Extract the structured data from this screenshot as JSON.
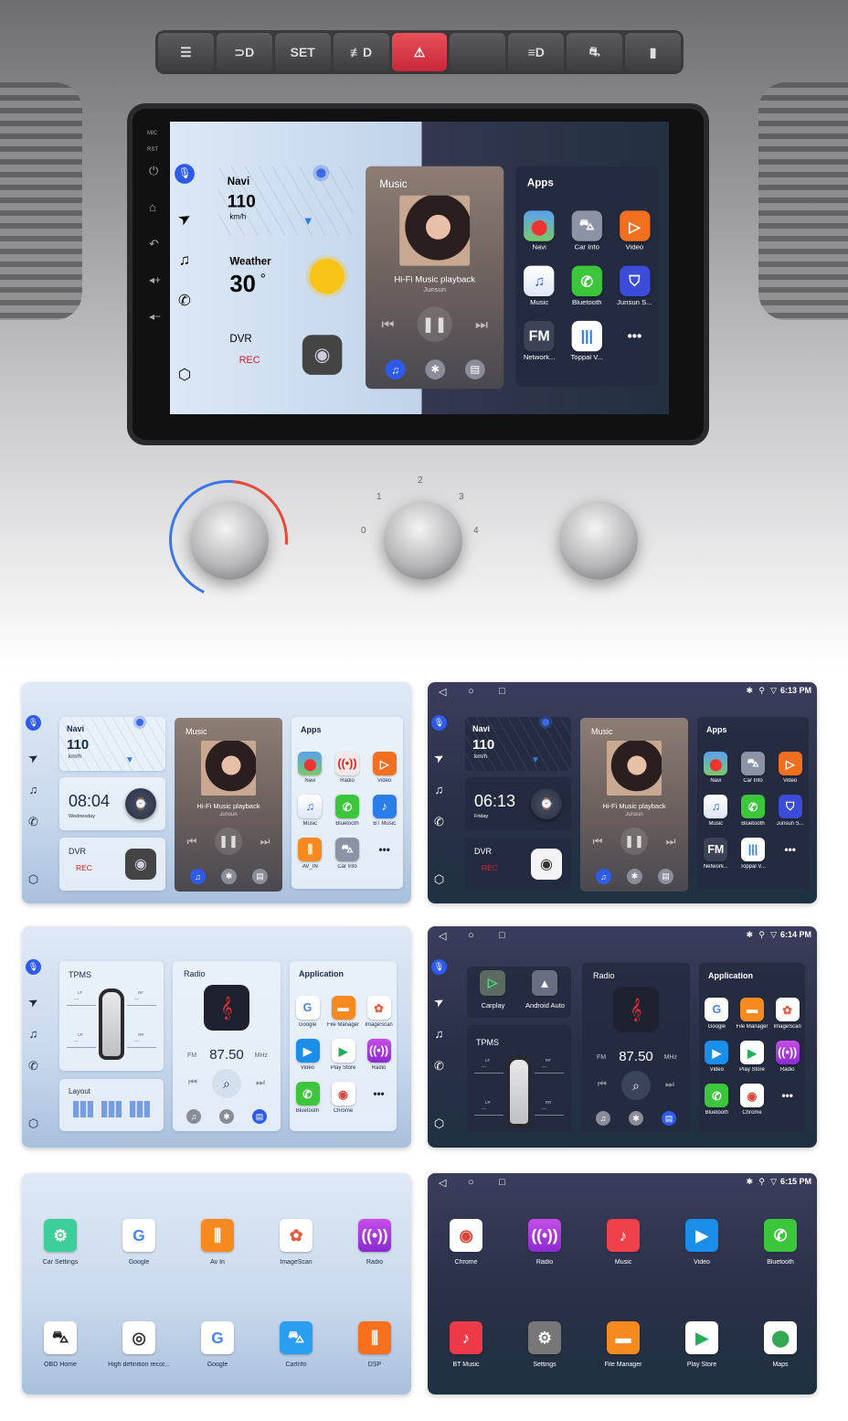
{
  "dashboard": {
    "buttons": [
      "☰",
      "⊃D",
      "SET",
      "≢D",
      "⚠",
      "",
      "≡D",
      "⛐",
      "▮"
    ],
    "knob_labels": [
      "0",
      "1",
      "2",
      "3",
      "4"
    ],
    "sidebar_labels": [
      "MIC",
      "RST"
    ]
  },
  "colors": {
    "accent": "#2f5bea",
    "rec": "#d8202a",
    "hazard": "#d8303e"
  },
  "main_screen": {
    "theme": "split",
    "navi": {
      "title": "Navi",
      "speed": "110",
      "unit": "km/h"
    },
    "card2": {
      "kind": "weather",
      "title": "Weather",
      "value": "30",
      "unit": "°"
    },
    "dvr": {
      "title": "DVR",
      "status": "REC"
    },
    "music": {
      "title": "Music",
      "track": "Hi-Fi Music playback",
      "artist": "Junsun"
    },
    "apps": {
      "title": "Apps",
      "items": [
        {
          "label": "Navi",
          "icon": "navi"
        },
        {
          "label": "Car Info",
          "icon": "car-info"
        },
        {
          "label": "Video",
          "icon": "video"
        },
        {
          "label": "Music",
          "icon": "music"
        },
        {
          "label": "Bluetooth",
          "icon": "bluetooth"
        },
        {
          "label": "Junsun S...",
          "icon": "junsun"
        },
        {
          "label": "Network...",
          "icon": "network-fm"
        },
        {
          "label": "Toppal V...",
          "icon": "toppal"
        },
        {
          "label": "",
          "icon": "more"
        }
      ]
    }
  },
  "screens": [
    {
      "type": "home1",
      "theme": "light",
      "navi": {
        "title": "Navi",
        "speed": "110",
        "unit": "km/h"
      },
      "card2": {
        "kind": "clock",
        "value": "08:04",
        "day": "Wednesday"
      },
      "dvr": {
        "title": "DVR",
        "status": "REC"
      },
      "music": {
        "title": "Music",
        "track": "Hi-Fi Music playback",
        "artist": "Junsun"
      },
      "apps": {
        "title": "Apps",
        "items": [
          {
            "label": "Navi",
            "icon": "navi"
          },
          {
            "label": "Radio",
            "icon": "radio-red"
          },
          {
            "label": "Video",
            "icon": "video"
          },
          {
            "label": "Music",
            "icon": "music"
          },
          {
            "label": "Bluetooth",
            "icon": "bluetooth"
          },
          {
            "label": "BT Music",
            "icon": "bt-music-blue"
          },
          {
            "label": "AV_IN",
            "icon": "av-in"
          },
          {
            "label": "Car Info",
            "icon": "car-info"
          },
          {
            "label": "",
            "icon": "more"
          }
        ]
      }
    },
    {
      "type": "home1",
      "theme": "dark",
      "time": "6:13 PM",
      "navi": {
        "title": "Navi",
        "speed": "110",
        "unit": "km/h"
      },
      "card2": {
        "kind": "clock",
        "value": "06:13",
        "day": "Friday"
      },
      "dvr": {
        "title": "DVR",
        "status": "REC"
      },
      "music": {
        "title": "Music",
        "track": "Hi-Fi Music playback",
        "artist": "Junsun"
      },
      "apps": {
        "title": "Apps",
        "items": [
          {
            "label": "Navi",
            "icon": "navi"
          },
          {
            "label": "Car Info",
            "icon": "car-info"
          },
          {
            "label": "Video",
            "icon": "video"
          },
          {
            "label": "Music",
            "icon": "music"
          },
          {
            "label": "Bluetooth",
            "icon": "bluetooth"
          },
          {
            "label": "Junsun S...",
            "icon": "junsun"
          },
          {
            "label": "Network...",
            "icon": "network-fm"
          },
          {
            "label": "Toppal V...",
            "icon": "toppal"
          },
          {
            "label": "",
            "icon": "more"
          }
        ]
      }
    },
    {
      "type": "home2",
      "theme": "light",
      "tpms": {
        "title": "TPMS",
        "lf": "LF",
        "rf": "RF",
        "lr": "LR",
        "rr": "RR",
        "value": "---"
      },
      "layout": {
        "title": "Layout"
      },
      "radio": {
        "title": "Radio",
        "band": "FM",
        "freq": "87.50",
        "unit": "MHz"
      },
      "apps": {
        "title": "Application",
        "items": [
          {
            "label": "Google",
            "icon": "google"
          },
          {
            "label": "File Manager",
            "icon": "file-manager"
          },
          {
            "label": "ImageScan",
            "icon": "imagescan"
          },
          {
            "label": "Video",
            "icon": "video-blue"
          },
          {
            "label": "Play Store",
            "icon": "play-store"
          },
          {
            "label": "Radio",
            "icon": "radio"
          },
          {
            "label": "Bluetooth",
            "icon": "bluetooth"
          },
          {
            "label": "Chrome",
            "icon": "chrome"
          },
          {
            "label": "",
            "icon": "more"
          }
        ]
      }
    },
    {
      "type": "home2",
      "theme": "dark",
      "time": "6:14 PM",
      "projection": [
        {
          "label": "Carplay",
          "icon": "carplay"
        },
        {
          "label": "Android Auto",
          "icon": "android-auto"
        }
      ],
      "tpms": {
        "title": "TPMS",
        "lf": "LF",
        "rf": "RF",
        "lr": "LR",
        "rr": "RR",
        "value": "---"
      },
      "radio": {
        "title": "Radio",
        "band": "FM",
        "freq": "87.50",
        "unit": "MHz"
      },
      "apps": {
        "title": "Application",
        "items": [
          {
            "label": "Google",
            "icon": "google"
          },
          {
            "label": "File Manager",
            "icon": "file-manager"
          },
          {
            "label": "ImageScan",
            "icon": "imagescan"
          },
          {
            "label": "Video",
            "icon": "video-blue"
          },
          {
            "label": "Play Store",
            "icon": "play-store"
          },
          {
            "label": "Radio",
            "icon": "radio"
          },
          {
            "label": "Bluetooth",
            "icon": "bluetooth"
          },
          {
            "label": "Chrome",
            "icon": "chrome"
          },
          {
            "label": "",
            "icon": "more"
          }
        ]
      }
    },
    {
      "type": "grid",
      "theme": "light",
      "items": [
        {
          "label": "Car Settings",
          "icon": "car-settings"
        },
        {
          "label": "Google",
          "icon": "google"
        },
        {
          "label": "Av In",
          "icon": "av-in"
        },
        {
          "label": "ImageScan",
          "icon": "imagescan"
        },
        {
          "label": "Radio",
          "icon": "radio"
        },
        {
          "label": "OBD Home",
          "icon": "obd"
        },
        {
          "label": "High definition recor...",
          "icon": "camera-lens"
        },
        {
          "label": "Google",
          "icon": "google"
        },
        {
          "label": "CarInfo",
          "icon": "carinfo-blue"
        },
        {
          "label": "DSP",
          "icon": "dsp"
        }
      ]
    },
    {
      "type": "grid",
      "theme": "dark",
      "time": "6:15 PM",
      "items": [
        {
          "label": "Chrome",
          "icon": "chrome"
        },
        {
          "label": "Radio",
          "icon": "radio"
        },
        {
          "label": "Music",
          "icon": "music-red"
        },
        {
          "label": "Video",
          "icon": "video-blue"
        },
        {
          "label": "Bluetooth",
          "icon": "bluetooth"
        },
        {
          "label": "BT Music",
          "icon": "bt-music"
        },
        {
          "label": "Settings",
          "icon": "settings"
        },
        {
          "label": "File Manager",
          "icon": "file-manager"
        },
        {
          "label": "Play Store",
          "icon": "play-store"
        },
        {
          "label": "Maps",
          "icon": "maps"
        }
      ]
    }
  ]
}
